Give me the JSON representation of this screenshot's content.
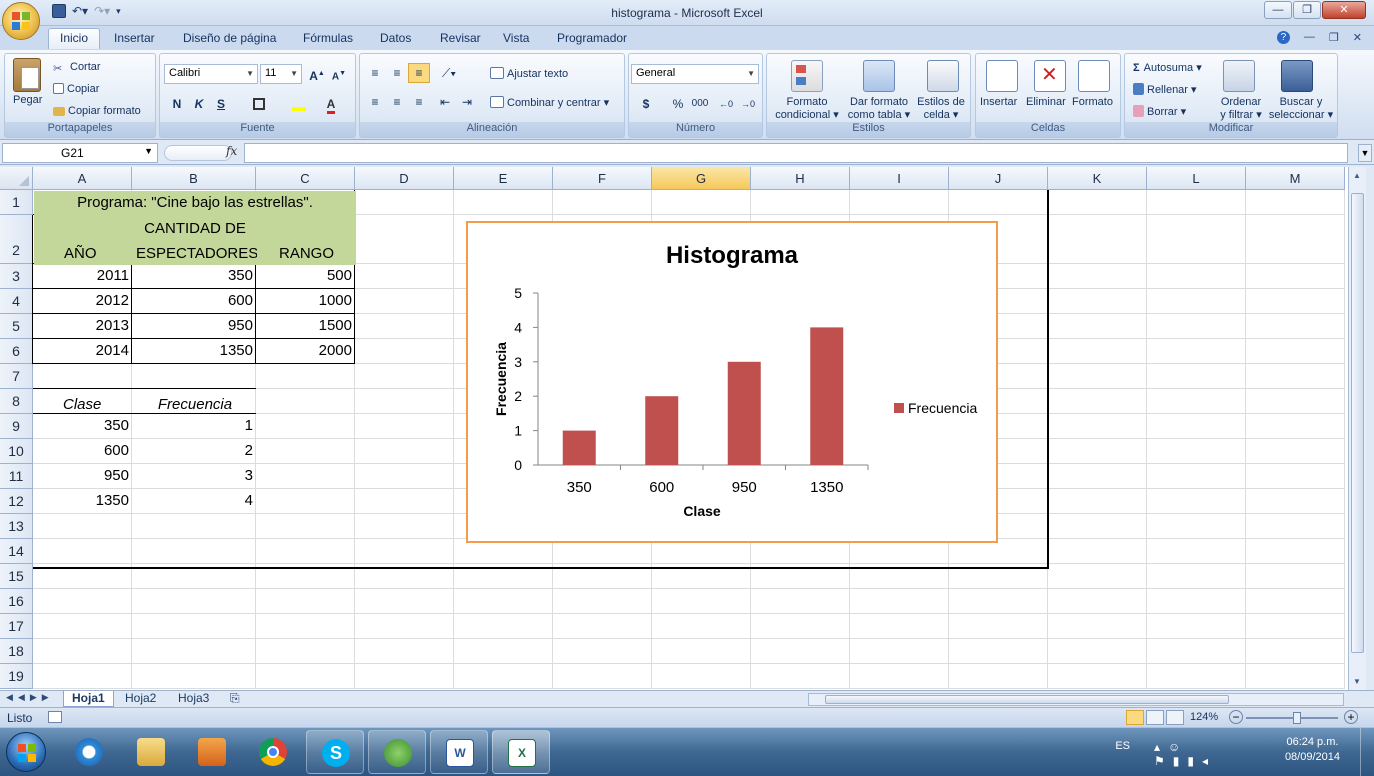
{
  "window": {
    "title": "histograma - Microsoft Excel",
    "controls": [
      "—",
      "❐",
      "✕"
    ]
  },
  "tabs": [
    "Inicio",
    "Insertar",
    "Diseño de página",
    "Fórmulas",
    "Datos",
    "Revisar",
    "Vista",
    "Programador"
  ],
  "ribbon": {
    "portapapeles": {
      "label": "Portapapeles",
      "pegar": "Pegar",
      "cortar": "Cortar",
      "copiar": "Copiar",
      "copiar_formato": "Copiar formato"
    },
    "fuente": {
      "label": "Fuente",
      "font_name": "Calibri",
      "font_size": "11",
      "bold": "N",
      "italic": "K",
      "underline": "S"
    },
    "alineacion": {
      "label": "Alineación",
      "ajustar_texto": "Ajustar texto",
      "combinar": "Combinar y centrar"
    },
    "numero": {
      "label": "Número",
      "format": "General",
      "currency": "$",
      "percent": "%",
      "thousands": "000"
    },
    "estilos": {
      "label": "Estilos",
      "formato_condicional": [
        "Formato",
        "condicional"
      ],
      "dar_formato": [
        "Dar formato",
        "como tabla"
      ],
      "estilos_celda": [
        "Estilos de",
        "celda"
      ]
    },
    "celdas": {
      "label": "Celdas",
      "insertar": "Insertar",
      "eliminar": "Eliminar",
      "formato": "Formato"
    },
    "modificar": {
      "label": "Modificar",
      "autosuma": "Autosuma",
      "rellenar": "Rellenar",
      "borrar": "Borrar",
      "ordenar": [
        "Ordenar",
        "y filtrar"
      ],
      "buscar": [
        "Buscar y",
        "seleccionar"
      ]
    }
  },
  "formula_bar": {
    "name_box": "G21",
    "fx": "fx",
    "formula": ""
  },
  "columns": [
    "A",
    "B",
    "C",
    "D",
    "E",
    "F",
    "G",
    "H",
    "I",
    "J",
    "K",
    "L",
    "M"
  ],
  "selected_column": "G",
  "rows": [
    "1",
    "2",
    "3",
    "4",
    "5",
    "6",
    "7",
    "8",
    "9",
    "10",
    "11",
    "12",
    "13",
    "14",
    "15",
    "16",
    "17",
    "18",
    "19"
  ],
  "cells": {
    "A1": "Programa: \"Cine bajo las estrellas\".",
    "A2": "AÑO",
    "B2_line1": "CANTIDAD DE",
    "B2_line2": "ESPECTADORES",
    "C2": "RANGO",
    "data": [
      [
        "2011",
        "350",
        "500"
      ],
      [
        "2012",
        "600",
        "1000"
      ],
      [
        "2013",
        "950",
        "1500"
      ],
      [
        "2014",
        "1350",
        "2000"
      ]
    ],
    "A8": "Clase",
    "B8": "Frecuencia",
    "freq": [
      [
        "350",
        "1"
      ],
      [
        "600",
        "2"
      ],
      [
        "950",
        "3"
      ],
      [
        "1350",
        "4"
      ]
    ]
  },
  "chart_data": {
    "type": "bar",
    "title": "Histograma",
    "xlabel": "Clase",
    "ylabel": "Frecuencia",
    "categories": [
      "350",
      "600",
      "950",
      "1350"
    ],
    "series": [
      {
        "name": "Frecuencia",
        "values": [
          1,
          2,
          3,
          4
        ],
        "color": "#c0504d"
      }
    ],
    "ylim": [
      0,
      5
    ],
    "yticks": [
      "0",
      "1",
      "2",
      "3",
      "4",
      "5"
    ],
    "legend": "right",
    "grid": false
  },
  "sheets": [
    "Hoja1",
    "Hoja2",
    "Hoja3"
  ],
  "active_sheet": "Hoja1",
  "status": {
    "ready": "Listo",
    "zoom": "124%"
  },
  "taskbar": {
    "lang": "ES",
    "time": "06:24 p.m.",
    "date": "08/09/2014"
  }
}
